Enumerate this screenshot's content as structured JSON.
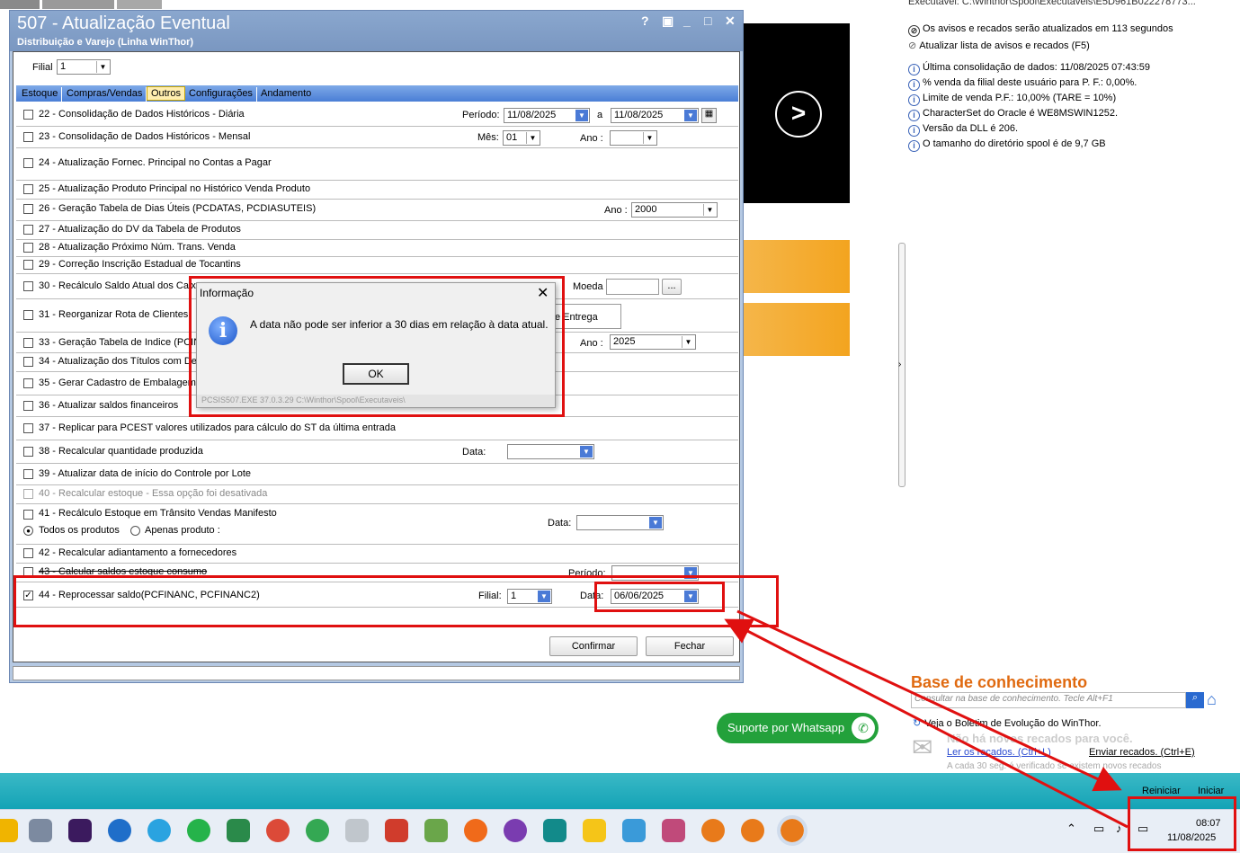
{
  "window": {
    "title": "507 - Atualização Eventual",
    "subtitle": "Distribuição e Varejo (Linha WinThor)",
    "controls": [
      "?",
      "▣",
      "_",
      "□",
      "✕"
    ]
  },
  "filial": {
    "label": "Filial",
    "value": "1"
  },
  "tabs": [
    "Estoque",
    "Compras/Vendas",
    "Outros",
    "Configurações",
    "Andamento"
  ],
  "active_tab": "Outros",
  "rows": {
    "r22": {
      "label": "22 - Consolidação de Dados Históricos - Diária",
      "periodo_label": "Período:",
      "from": "11/08/2025",
      "a_label": "a",
      "to": "11/08/2025"
    },
    "r23": {
      "label": "23 - Consolidação de Dados Históricos - Mensal",
      "mes_label": "Mês:",
      "mes": "01",
      "ano_label": "Ano :",
      "ano": ""
    },
    "r24": {
      "label": "24 - Atualização Fornec. Principal no Contas a Pagar"
    },
    "r25": {
      "label": "25 - Atualização Produto Principal no Histórico Venda Produto"
    },
    "r26": {
      "label": "26 - Geração Tabela de Dias Úteis (PCDATAS, PCDIASUTEIS)",
      "ano_label": "Ano :",
      "ano": "2000"
    },
    "r27": {
      "label": "27 - Atualização do DV da Tabela de Produtos"
    },
    "r28": {
      "label": "28 - Atualização Próximo Núm. Trans. Venda"
    },
    "r29": {
      "label": "29 - Correção Inscrição Estadual de Tocantins"
    },
    "r30": {
      "label": "30 - Recálculo Saldo Atual dos Caixa",
      "moeda_label": "Moeda",
      "moeda_btn": "..."
    },
    "r31": {
      "label": "31 - Reorganizar Rota de Clientes",
      "entrega_label": "e Entrega"
    },
    "r33": {
      "label": "33 - Geração Tabela de Indice (PCIN",
      "ano_label": "Ano :",
      "ano": "2025"
    },
    "r34": {
      "label": "34 - Atualização dos Títulos com Des"
    },
    "r35": {
      "label": "35 - Gerar Cadastro de Embalagem d"
    },
    "r36": {
      "label": "36 - Atualizar saldos financeiros"
    },
    "r37": {
      "label": "37 - Replicar para PCEST valores utilizados para cálculo do ST da última entrada"
    },
    "r38": {
      "label": "38 - Recalcular quantidade produzida",
      "data_label": "Data:"
    },
    "r39": {
      "label": "39 - Atualizar data de início do Controle por Lote"
    },
    "r40": {
      "label": "40 - Recalcular estoque - Essa opção foi desativada"
    },
    "r41": {
      "label": "41 - Recálculo Estoque em Trânsito Vendas Manifesto",
      "opt1": "Todos os produtos",
      "opt2": "Apenas produto :",
      "data_label": "Data:"
    },
    "r42": {
      "label": "42 - Recalcular adiantamento a fornecedores"
    },
    "r43": {
      "label": "43 - Calcular saldos estoque consumo",
      "periodo_label": "Período:"
    },
    "r44": {
      "label": "44 - Reprocessar saldo(PCFINANC, PCFINANC2)",
      "filial_label": "Filial:",
      "filial": "1",
      "data_label": "Data:",
      "data": "06/06/2025",
      "checked": true
    }
  },
  "buttons": {
    "confirm": "Confirmar",
    "close": "Fechar"
  },
  "dialog": {
    "title": "Informação",
    "message": "A data não pode ser inferior a 30 dias em relação à data atual.",
    "ok": "OK",
    "footer": "PCSIS507.EXE 37.0.3.29 C:\\Winthor\\Spool\\Executaveis\\"
  },
  "right_panel": {
    "top_text": "Executável: C:\\Winthor\\Spool\\Executaveis\\E5D961B022278773...",
    "notices": "Os avisos e recados serão atualizados em 113 segundos",
    "refresh": "Atualizar lista de avisos e recados (F5)",
    "info": [
      "Última consolidação de dados: 11/08/2025 07:43:59",
      "% venda da filial deste usuário para P. F.: 0,00%.",
      "Limite de venda P.F.: 10,00% (TARE = 10%)",
      "CharacterSet do Oracle é WE8MSWIN1252.",
      "Versão da DLL é 206.",
      "O tamanho do diretório spool é de 9,7 GB"
    ],
    "kb_title": "Base de conhecimento",
    "kb_placeholder": "Consultar na base de conhecimento. Tecle Alt+F1",
    "bulletin": "Veja o Boletim de Evolução do WinThor.",
    "no_messages": "Não há novos recados para você.",
    "read_messages": "Ler os recados. (Ctrl+L)",
    "send_messages": "Enviar recados. (Ctrl+E)",
    "check_text": "A cada 30 seg. é verificado se existem novos recados",
    "whatsapp": "Suporte por Whatsapp",
    "restart": "Reiniciar",
    "start": "Iniciar"
  },
  "taskbar": {
    "time": "08:07",
    "date": "11/08/2025"
  },
  "colors": {
    "window_title": "#7a97c1",
    "highlight": "#e01010",
    "whatsapp": "#23a13b",
    "kb_title": "#e06a10"
  }
}
